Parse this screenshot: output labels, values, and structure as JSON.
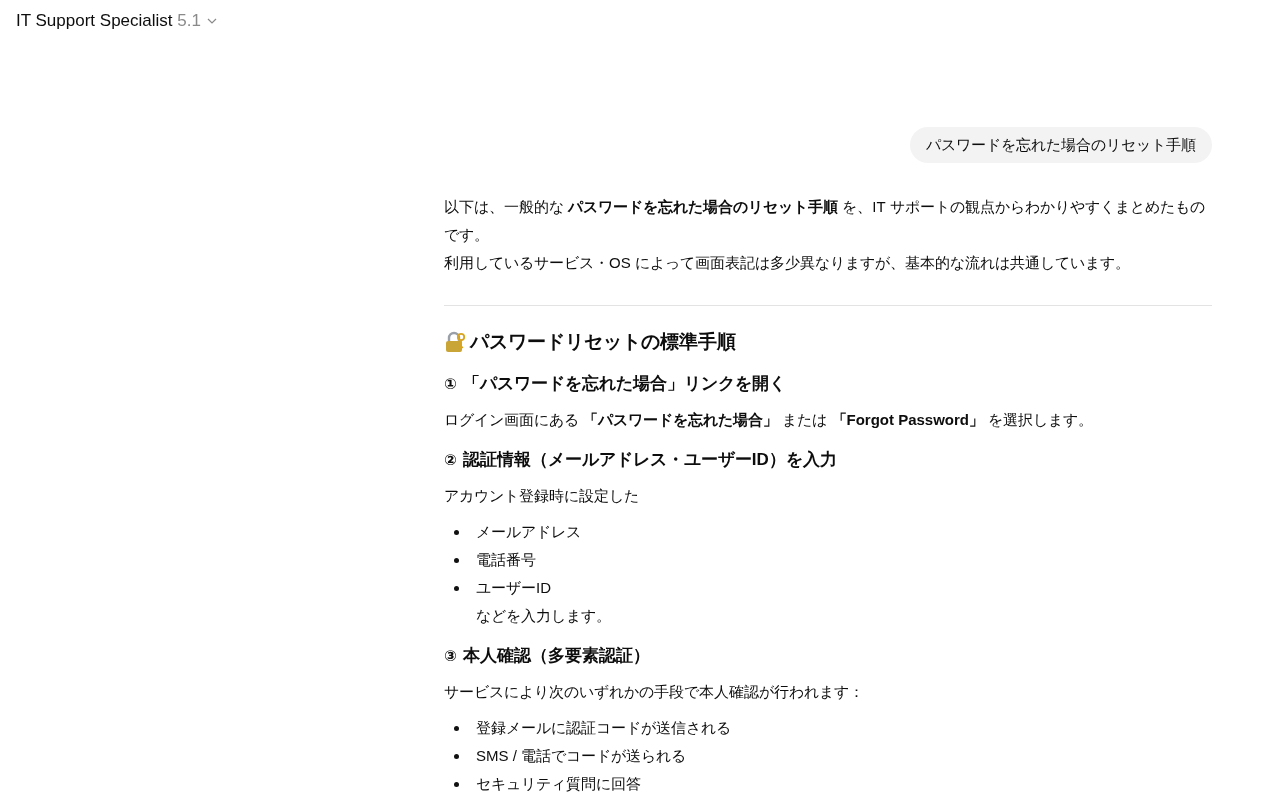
{
  "header": {
    "title": "IT Support Specialist",
    "version": "5.1"
  },
  "user_message": "パスワードを忘れた場合のリセット手順",
  "response": [
    {
      "kind": "paragraph",
      "lines": [
        "以下は、一般的な **パスワードを忘れた場合のリセット手順** を、IT サポートの観点からわかりやすくまとめたものです。",
        "利用しているサービス・OS によって画面表記は多少異なりますが、基本的な流れは共通しています。"
      ]
    },
    {
      "kind": "divider"
    },
    {
      "kind": "h2",
      "text": "パスワードリセットの標準手順"
    },
    {
      "kind": "h3",
      "number": "①",
      "text": "「パスワードを忘れた場合」リンクを開く"
    },
    {
      "kind": "paragraph",
      "lines": [
        "ログイン画面にある **「パスワードを忘れた場合」** または **「Forgot Password」** を選択します。"
      ]
    },
    {
      "kind": "h3",
      "number": "②",
      "text": "認証情報（メールアドレス・ユーザーID）を入力"
    },
    {
      "kind": "paragraph",
      "lines": [
        "アカウント登録時に設定した"
      ]
    },
    {
      "kind": "list",
      "items": [
        "メールアドレス",
        "電話番号",
        "ユーザーID"
      ]
    },
    {
      "kind": "note",
      "text": "などを入力します。"
    },
    {
      "kind": "h3",
      "number": "③",
      "text": "本人確認（多要素認証）"
    },
    {
      "kind": "paragraph",
      "lines": [
        "サービスにより次のいずれかの手段で本人確認が行われます："
      ]
    },
    {
      "kind": "list",
      "items": [
        "登録メールに認証コードが送信される",
        "SMS / 電話でコードが送られる",
        "セキュリティ質問に回答"
      ]
    }
  ]
}
